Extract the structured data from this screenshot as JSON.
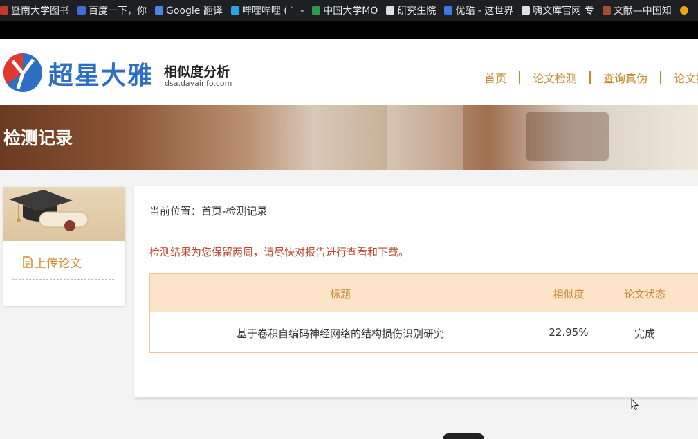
{
  "bookmarks": [
    {
      "label": "暨南大学图书",
      "color": "#c0392b"
    },
    {
      "label": "百度一下，你",
      "color": "#3a6fd8"
    },
    {
      "label": "Google 翻译",
      "color": "#4a86e8"
    },
    {
      "label": "哔哩哔哩 ( ゜-",
      "color": "#26a5e8"
    },
    {
      "label": "中国大学MO",
      "color": "#2a9d4a"
    },
    {
      "label": "研究生院",
      "color": "#e0e0e0"
    },
    {
      "label": "优酷 - 这世界",
      "color": "#3a7ae0"
    },
    {
      "label": "嗨文库官网 专",
      "color": "#e0e0e0"
    },
    {
      "label": "文献—中国知",
      "color": "#a05030"
    },
    {
      "label": "",
      "color": "#e6a817"
    }
  ],
  "header": {
    "logo_name": "超星大雅",
    "logo_sub": "相似度分析",
    "logo_url": "dsa.dayainfo.com",
    "nav": [
      "首页",
      "论文检测",
      "查询真伪",
      "论文搜"
    ]
  },
  "banner": {
    "title": "检测记录"
  },
  "sidebar": {
    "item_label": "上传论文"
  },
  "main": {
    "breadcrumb": "当前位置：首页-检测记录",
    "notice": "检测结果为您保留两周，请尽快对报告进行查看和下载。",
    "table": {
      "headers": {
        "title": "标题",
        "similarity": "相似度",
        "status": "论文状态"
      },
      "rows": [
        {
          "title": "基于卷积自编码神经网络的结构损伤识别研究",
          "similarity": "22.95%",
          "status": "完成"
        }
      ]
    }
  },
  "colors": {
    "accent": "#c8882a",
    "notice": "#b84a2e",
    "brand_blue": "#2d6fc4",
    "table_header_bg": "#fde3c8"
  }
}
